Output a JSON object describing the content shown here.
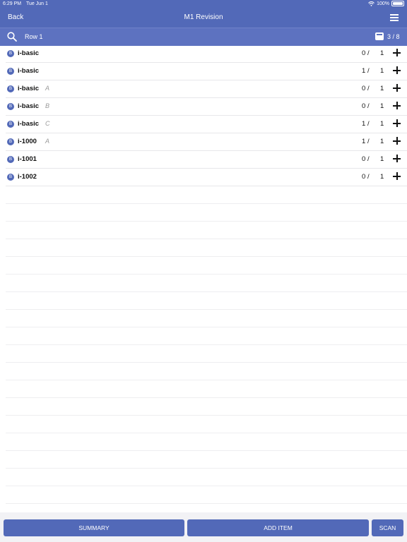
{
  "status_bar": {
    "time": "6:29 PM",
    "date": "Tue Jun 1",
    "battery": "100%"
  },
  "nav": {
    "back_label": "Back",
    "title": "M1 Revision",
    "menu_icon": "hamburger-icon"
  },
  "sub_bar": {
    "row_label": "Row 1",
    "count": "3 / 8"
  },
  "items": [
    {
      "badge": "B",
      "name": "i-basic",
      "rev": "",
      "qty": "0",
      "slash": "/",
      "total": "1"
    },
    {
      "badge": "B",
      "name": "i-basic",
      "rev": "",
      "qty": "1",
      "slash": "/",
      "total": "1"
    },
    {
      "badge": "B",
      "name": "i-basic",
      "rev": "A",
      "qty": "0",
      "slash": "/",
      "total": "1"
    },
    {
      "badge": "B",
      "name": "i-basic",
      "rev": "B",
      "qty": "0",
      "slash": "/",
      "total": "1"
    },
    {
      "badge": "B",
      "name": "i-basic",
      "rev": "C",
      "qty": "1",
      "slash": "/",
      "total": "1"
    },
    {
      "badge": "B",
      "name": "i-1000",
      "rev": "A",
      "qty": "1",
      "slash": "/",
      "total": "1"
    },
    {
      "badge": "B",
      "name": "i-1001",
      "rev": "",
      "qty": "0",
      "slash": "/",
      "total": "1"
    },
    {
      "badge": "B",
      "name": "i-1002",
      "rev": "",
      "qty": "0",
      "slash": "/",
      "total": "1"
    }
  ],
  "bottom": {
    "summary_label": "SUMMARY",
    "add_item_label": "ADD ITEM",
    "scan_label": "SCAN"
  },
  "colors": {
    "primary": "#5269b8",
    "secondary_bar": "#5d72c0"
  }
}
